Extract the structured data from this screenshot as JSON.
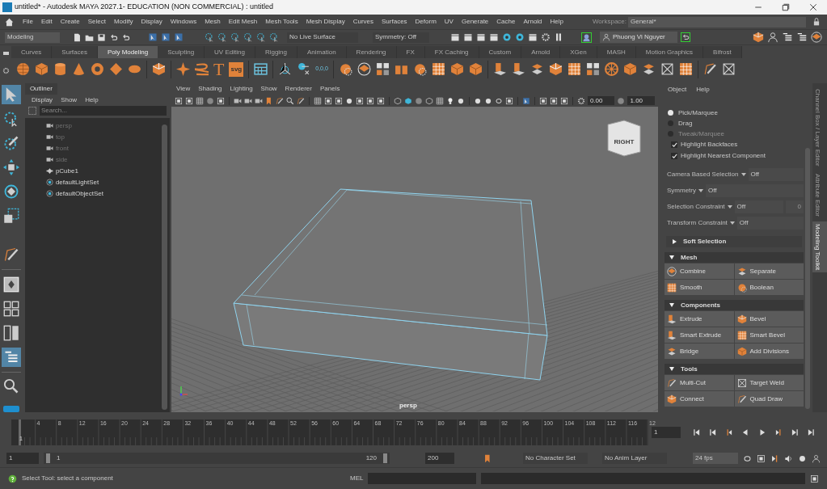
{
  "window": {
    "title": "untitled* - Autodesk MAYA 2027.1- EDUCATION (NON COMMERCIAL) : untitled"
  },
  "menu_bar": [
    "File",
    "Edit",
    "Create",
    "Select",
    "Modify",
    "Display",
    "Windows",
    "Mesh",
    "Edit Mesh",
    "Mesh Tools",
    "Mesh Display",
    "Curves",
    "Surfaces",
    "Deform",
    "UV",
    "Generate",
    "Cache",
    "Arnold",
    "Help"
  ],
  "workspace": {
    "label": "Workspace:",
    "value": "General*"
  },
  "status_line": {
    "mode": "Modeling",
    "live_surface": "No Live Surface",
    "symmetry": "Symmetry: Off",
    "user": "Phuong Vi Nguyer"
  },
  "shelf_tabs": [
    {
      "label": "Curves",
      "selected": false
    },
    {
      "label": "Surfaces",
      "selected": false
    },
    {
      "label": "Poly Modeling",
      "selected": true
    },
    {
      "label": "Sculpting",
      "selected": false
    },
    {
      "label": "UV Editing",
      "selected": false
    },
    {
      "label": "Rigging",
      "selected": false
    },
    {
      "label": "Animation",
      "selected": false
    },
    {
      "label": "Rendering",
      "selected": false
    },
    {
      "label": "FX",
      "selected": false
    },
    {
      "label": "FX Caching",
      "selected": false
    },
    {
      "label": "Custom",
      "selected": false
    },
    {
      "label": "Arnold",
      "selected": false
    },
    {
      "label": "XGen",
      "selected": false
    },
    {
      "label": "MASH",
      "selected": false
    },
    {
      "label": "Motion Graphics",
      "selected": false
    },
    {
      "label": "Bifrost",
      "selected": false
    }
  ],
  "shelf": {
    "texts": [
      "T",
      "svg",
      "0,0,0"
    ]
  },
  "outliner": {
    "title": "Outliner",
    "menus": [
      "Display",
      "Show",
      "Help"
    ],
    "placeholder": "Search...",
    "items": [
      {
        "label": "persp",
        "kind": "camera"
      },
      {
        "label": "top",
        "kind": "camera"
      },
      {
        "label": "front",
        "kind": "camera"
      },
      {
        "label": "side",
        "kind": "camera"
      },
      {
        "label": "pCube1",
        "kind": "mesh"
      },
      {
        "label": "defaultLightSet",
        "kind": "set"
      },
      {
        "label": "defaultObjectSet",
        "kind": "set"
      }
    ]
  },
  "viewport": {
    "menus": [
      "View",
      "Shading",
      "Lighting",
      "Show",
      "Renderer",
      "Panels"
    ],
    "fields": [
      "0.00",
      "1.00"
    ],
    "view_cube": "RIGHT",
    "camera": "persp"
  },
  "toolkit": {
    "menus": [
      "Object",
      "Help"
    ],
    "modes": [
      {
        "label": "Pick/Marquee",
        "selected": true,
        "disabled": false
      },
      {
        "label": "Drag",
        "selected": false,
        "disabled": false
      },
      {
        "label": "Tweak/Marquee",
        "selected": false,
        "disabled": true
      }
    ],
    "checks": [
      {
        "label": "Highlight Backfaces",
        "checked": true
      },
      {
        "label": "Highlight Nearest Component",
        "checked": true
      }
    ],
    "options": [
      {
        "label": "Camera Based Selection",
        "value": "Off"
      },
      {
        "label": "Symmetry",
        "value": "Off"
      },
      {
        "label": "Selection Constraint",
        "value": "Off",
        "extra": "0"
      },
      {
        "label": "Transform Constraint",
        "value": "Off"
      }
    ],
    "soft_selection": {
      "label": "Soft Selection",
      "expanded": false
    },
    "sections": [
      {
        "title": "Mesh",
        "expanded": true,
        "buttons": [
          "Combine",
          "Separate",
          "Smooth",
          "Boolean"
        ]
      },
      {
        "title": "Components",
        "expanded": true,
        "buttons": [
          "Extrude",
          "Bevel",
          "Smart Extrude",
          "Smart Bevel",
          "Bridge",
          "Add Divisions"
        ]
      },
      {
        "title": "Tools",
        "expanded": true,
        "buttons": [
          "Multi-Cut",
          "Target Weld",
          "Connect",
          "Quad Draw"
        ]
      }
    ]
  },
  "side_tabs": [
    {
      "label": "Channel Box / Layer Editor",
      "selected": false
    },
    {
      "label": "Attribute Editor",
      "selected": false
    },
    {
      "label": "Modeling Toolkit",
      "selected": true
    }
  ],
  "time_slider": {
    "ticks": [
      "4",
      "8",
      "12",
      "16",
      "20",
      "24",
      "28",
      "32",
      "36",
      "40",
      "44",
      "48",
      "52",
      "56",
      "60",
      "64",
      "68",
      "72",
      "76",
      "80",
      "84",
      "88",
      "92",
      "96",
      "100",
      "104",
      "108",
      "112",
      "116",
      "12"
    ],
    "current": "1",
    "frame_field": "1"
  },
  "range_slider": {
    "level": 1,
    "start": "1",
    "range_start": "1",
    "range_end": "120",
    "end": "200",
    "character_set": "No Character Set",
    "anim_layer": "No Anim Layer",
    "fps": "24 fps"
  },
  "help_line": {
    "text": "Select Tool: select a component",
    "command_label": "MEL"
  }
}
